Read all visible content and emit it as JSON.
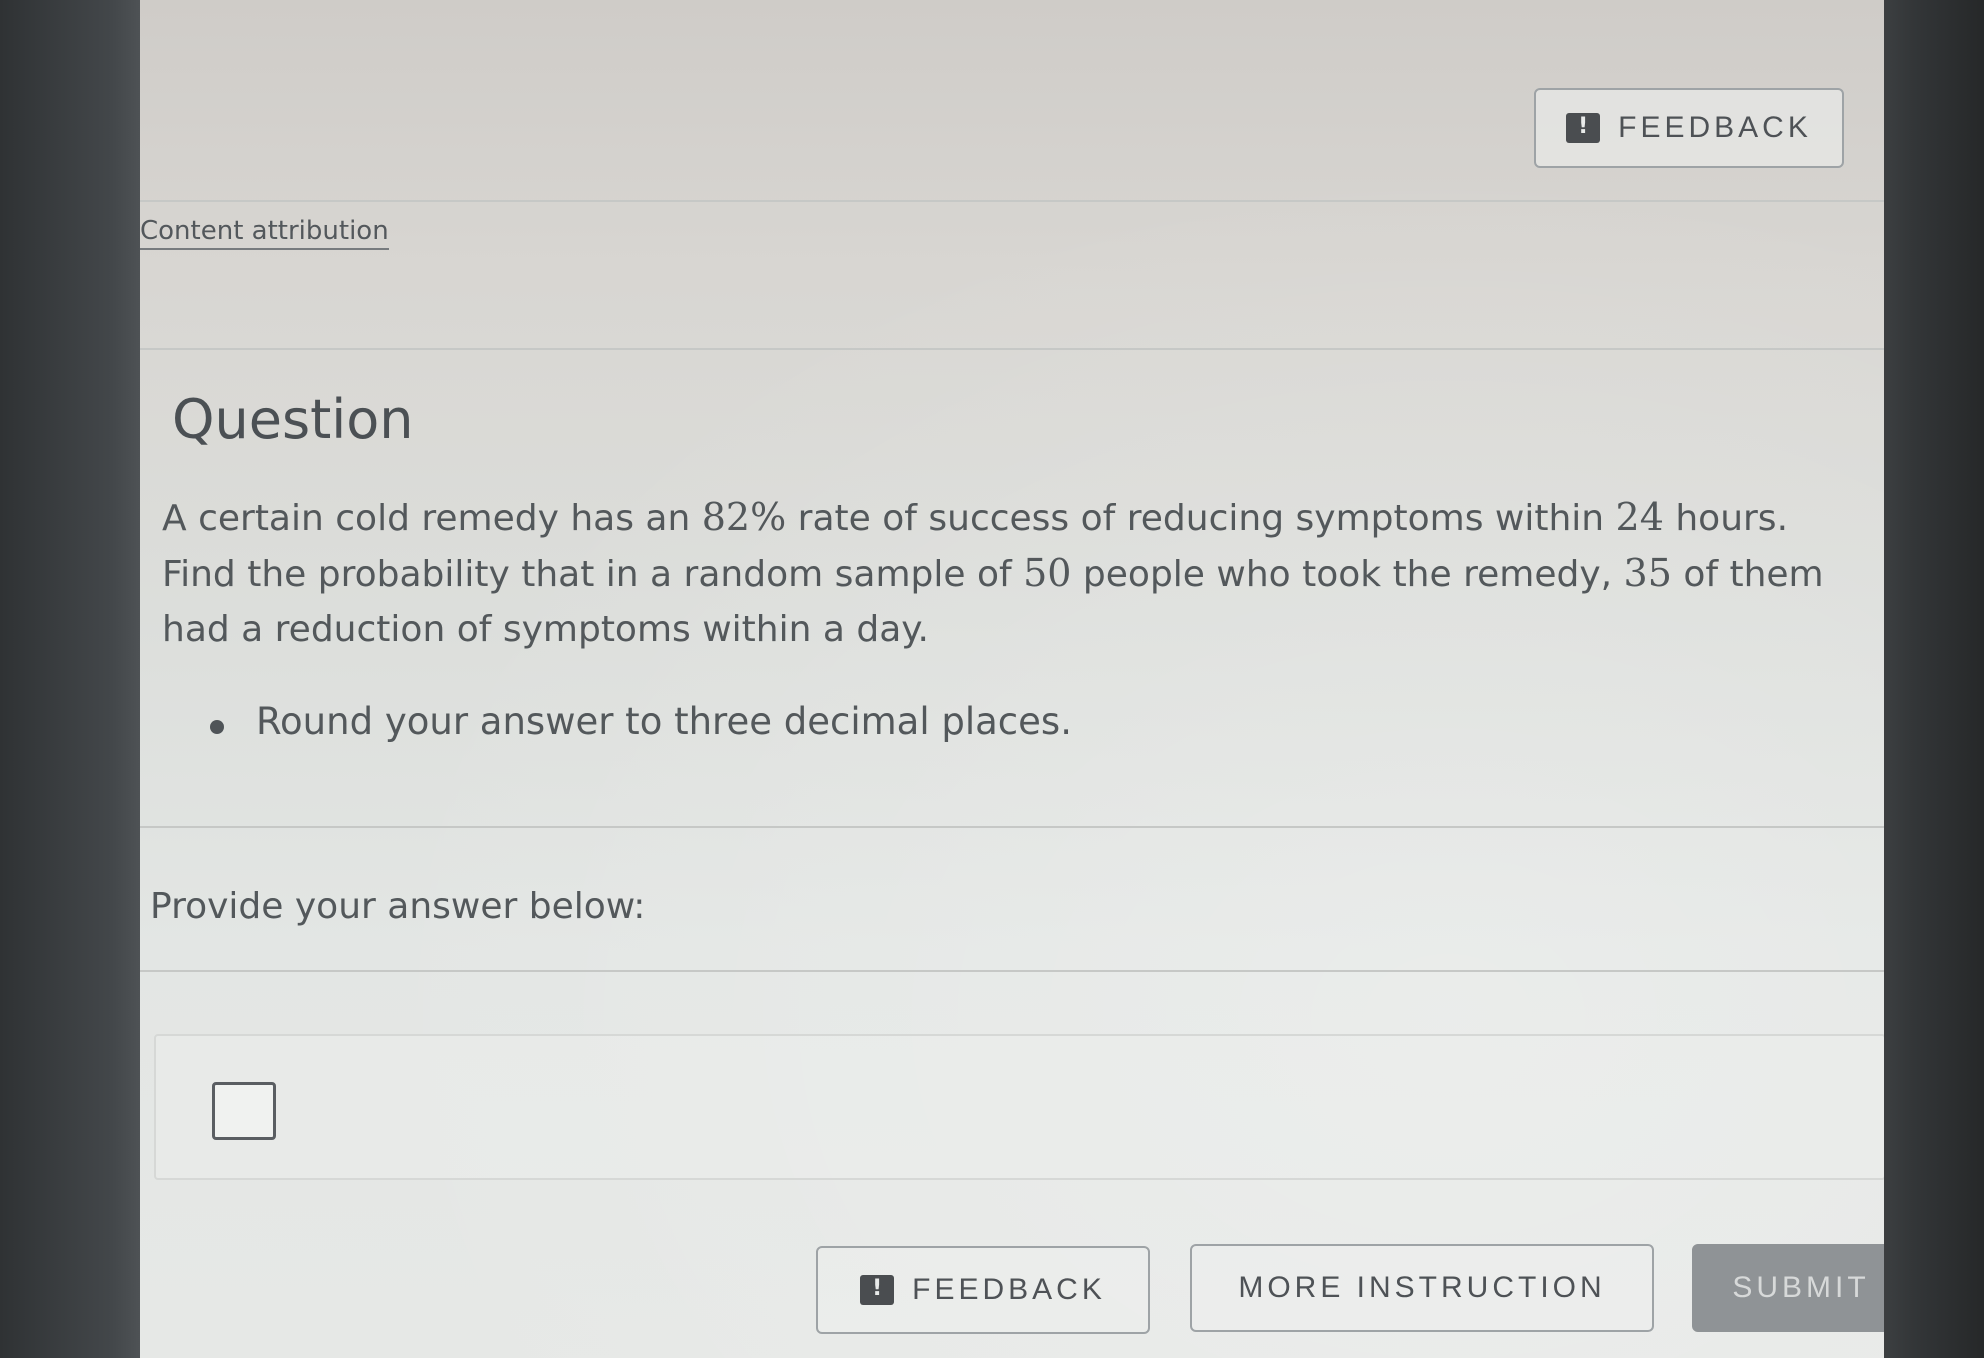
{
  "header": {
    "feedback_label": "FEEDBACK"
  },
  "attribution": {
    "label": "Content attribution"
  },
  "question": {
    "heading": "Question",
    "text_1": "A certain cold remedy has an ",
    "percent": "82%",
    "text_2": " rate of success of reducing symptoms within ",
    "hours": "24",
    "text_3": " hours. Find the probability that in a random sample of ",
    "sample_size": "50",
    "text_4": " people who took the remedy, ",
    "successes": "35",
    "text_5": " of them had a reduction of symptoms within a day.",
    "instructions": [
      "Round your answer to three decimal places."
    ]
  },
  "answer": {
    "prompt": "Provide your answer below:",
    "value": ""
  },
  "footer": {
    "feedback_label": "FEEDBACK",
    "more_instruction_label": "MORE INSTRUCTION",
    "submit_label": "SUBMIT"
  },
  "icons": {
    "feedback": "feedback-icon"
  },
  "colors": {
    "submit_bg": "#8f9396",
    "text": "#53585b"
  }
}
